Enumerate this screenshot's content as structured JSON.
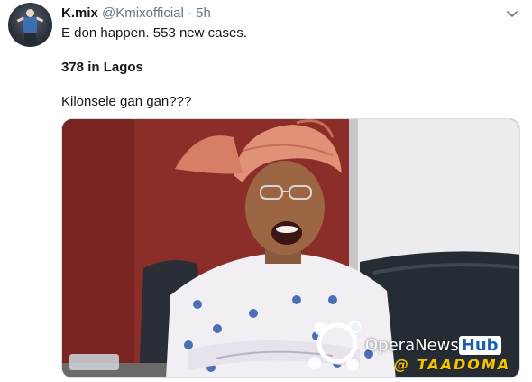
{
  "tweet": {
    "author": {
      "name": "K.mix",
      "handle": "@Kmixofficial",
      "separator": "·",
      "time": "5h"
    },
    "lines": [
      "E don happen. 553 new cases.",
      "378 in Lagos",
      "Kilonsele gan gan???"
    ],
    "media": {
      "watermark": {
        "brand": "OperaNews",
        "brand_box": "Hub",
        "credit": "@ TAADOMA"
      }
    }
  },
  "icons": {
    "menu": "chevron-down-icon",
    "watermark": "operanews-logo-icon"
  },
  "colors": {
    "text": "#14171a",
    "muted": "#657786",
    "wall": "#8b2e2a",
    "gele": "#e09177"
  }
}
